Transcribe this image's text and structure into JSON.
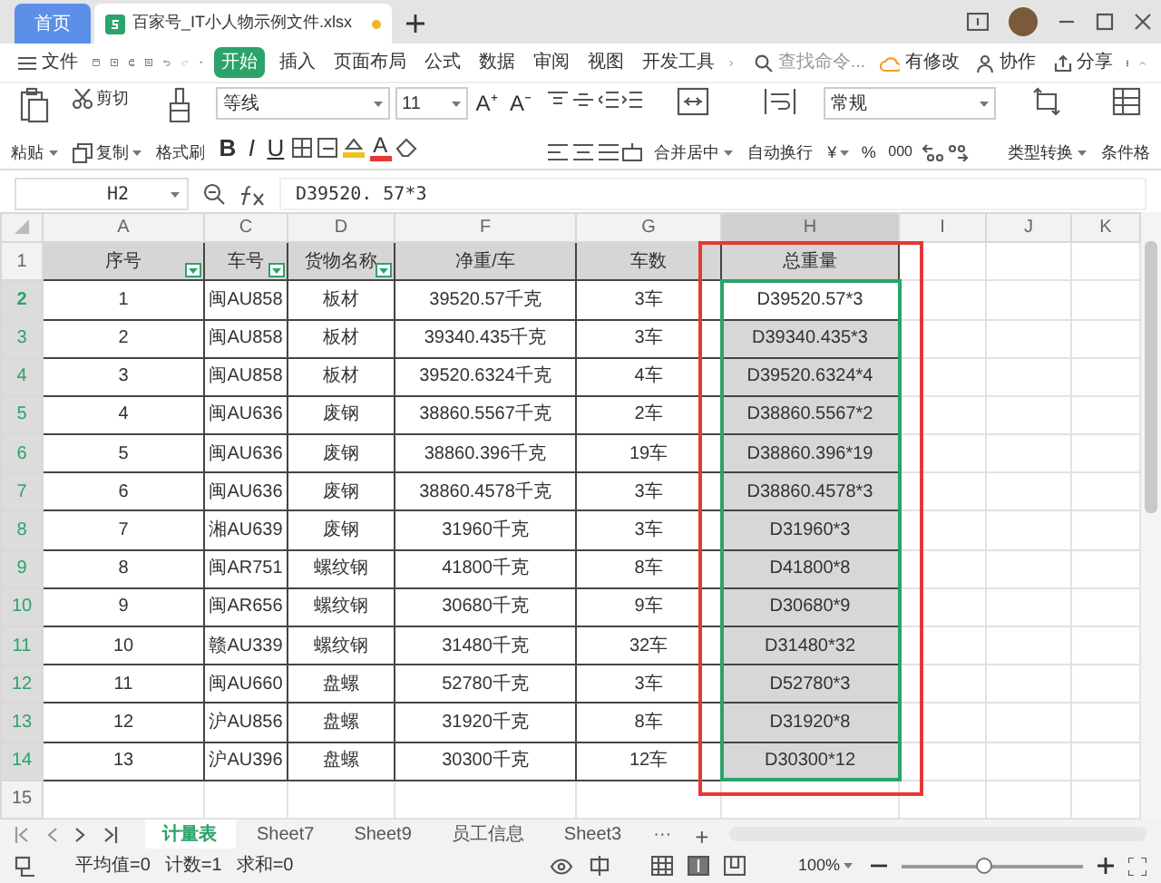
{
  "tabs": [
    {
      "label": "首页",
      "kind": "home",
      "selected": false
    },
    {
      "label": "百家号_IT小人物示例文件.xlsx",
      "kind": "file",
      "selected": true
    }
  ],
  "menu": {
    "file": "文件",
    "items": [
      {
        "label": "开始",
        "selected": true
      },
      {
        "label": "插入",
        "selected": false
      },
      {
        "label": "页面布局",
        "selected": false
      },
      {
        "label": "公式",
        "selected": false
      },
      {
        "label": "数据",
        "selected": false
      },
      {
        "label": "审阅",
        "selected": false
      },
      {
        "label": "视图",
        "selected": false
      },
      {
        "label": "开发工具",
        "selected": false
      }
    ],
    "search": {
      "placeholder": "查找命令..."
    },
    "actions": [
      "有修改",
      "协作",
      "分享"
    ]
  },
  "ribbon": {
    "paste": "粘贴",
    "cut": "剪切",
    "copy": "复制",
    "format_painter": "格式刷",
    "font": "等线",
    "font_size": "11",
    "grow_font": "A⁺",
    "shrink_font": "A⁻",
    "style_buttons": [
      "B",
      "I",
      "U"
    ],
    "font_color": "A",
    "merge": "合并居中",
    "wrap": "自动换行",
    "number_format": "常规",
    "currency": "¥",
    "percent": "%",
    "thousands": "000",
    "convert": "类型转换",
    "conditional": "条件格"
  },
  "name_box": "H2",
  "formula": "D39520. 57*3",
  "sheet": {
    "columns": [
      {
        "letter": "A",
        "selected": false
      },
      {
        "letter": "C",
        "selected": false
      },
      {
        "letter": "D",
        "selected": false
      },
      {
        "letter": "F",
        "selected": false
      },
      {
        "letter": "G",
        "selected": false
      },
      {
        "letter": "H",
        "selected": true
      },
      {
        "letter": "I",
        "selected": false
      },
      {
        "letter": "J",
        "selected": false
      },
      {
        "letter": "K",
        "selected": false
      }
    ],
    "header_row": {
      "number": "1",
      "cells": [
        {
          "text": "序号",
          "filter": true
        },
        {
          "text": "车号",
          "filter": true
        },
        {
          "text": "货物名称",
          "filter": true
        },
        {
          "text": "净重/车",
          "filter": false
        },
        {
          "text": "车数",
          "filter": false
        },
        {
          "text": "总重量",
          "filter": false
        }
      ]
    },
    "rows": [
      {
        "number": "2",
        "selected": true,
        "active": true,
        "cells": [
          "1",
          "闽AU858",
          "板材",
          "39520.57千克",
          "3车",
          "D39520.57*3"
        ]
      },
      {
        "number": "3",
        "selected": true,
        "active": false,
        "cells": [
          "2",
          "闽AU858",
          "板材",
          "39340.435千克",
          "3车",
          "D39340.435*3"
        ]
      },
      {
        "number": "4",
        "selected": true,
        "active": false,
        "cells": [
          "3",
          "闽AU858",
          "板材",
          "39520.6324千克",
          "4车",
          "D39520.6324*4"
        ]
      },
      {
        "number": "5",
        "selected": true,
        "active": false,
        "cells": [
          "4",
          "闽AU636",
          "废钢",
          "38860.5567千克",
          "2车",
          "D38860.5567*2"
        ]
      },
      {
        "number": "6",
        "selected": true,
        "active": false,
        "cells": [
          "5",
          "闽AU636",
          "废钢",
          "38860.396千克",
          "19车",
          "D38860.396*19"
        ]
      },
      {
        "number": "7",
        "selected": true,
        "active": false,
        "cells": [
          "6",
          "闽AU636",
          "废钢",
          "38860.4578千克",
          "3车",
          "D38860.4578*3"
        ]
      },
      {
        "number": "8",
        "selected": true,
        "active": false,
        "cells": [
          "7",
          "湘AU639",
          "废钢",
          "31960千克",
          "3车",
          "D31960*3"
        ]
      },
      {
        "number": "9",
        "selected": true,
        "active": false,
        "cells": [
          "8",
          "闽AR751",
          "螺纹钢",
          "41800千克",
          "8车",
          "D41800*8"
        ]
      },
      {
        "number": "10",
        "selected": true,
        "active": false,
        "cells": [
          "9",
          "闽AR656",
          "螺纹钢",
          "30680千克",
          "9车",
          "D30680*9"
        ]
      },
      {
        "number": "11",
        "selected": true,
        "active": false,
        "cells": [
          "10",
          "赣AU339",
          "螺纹钢",
          "31480千克",
          "32车",
          "D31480*32"
        ]
      },
      {
        "number": "12",
        "selected": true,
        "active": false,
        "cells": [
          "11",
          "闽AU660",
          "盘螺",
          "52780千克",
          "3车",
          "D52780*3"
        ]
      },
      {
        "number": "13",
        "selected": true,
        "active": false,
        "cells": [
          "12",
          "沪AU856",
          "盘螺",
          "31920千克",
          "8车",
          "D31920*8"
        ]
      },
      {
        "number": "14",
        "selected": true,
        "active": false,
        "cells": [
          "13",
          "沪AU396",
          "盘螺",
          "30300千克",
          "12车",
          "D30300*12"
        ]
      },
      {
        "number": "15",
        "selected": false,
        "active": false,
        "cells": []
      }
    ]
  },
  "sheet_tabs": [
    {
      "label": "计量表",
      "selected": true
    },
    {
      "label": "Sheet7",
      "selected": false
    },
    {
      "label": "Sheet9",
      "selected": false
    },
    {
      "label": "员工信息",
      "selected": false
    },
    {
      "label": "Sheet3",
      "selected": false
    }
  ],
  "sheet_more": "···",
  "sheet_add": "+",
  "status": [
    "平均值=0",
    "计数=1",
    "求和=0"
  ],
  "zoom": {
    "label": "100%",
    "level": 0.45
  }
}
